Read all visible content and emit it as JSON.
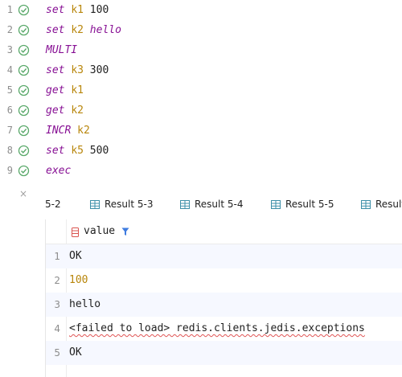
{
  "editor": {
    "lines": [
      {
        "num": "1",
        "parts": [
          "set",
          "k1",
          "100"
        ]
      },
      {
        "num": "2",
        "parts": [
          "set",
          "k2",
          "hello"
        ]
      },
      {
        "num": "3",
        "parts": [
          "MULTI"
        ]
      },
      {
        "num": "4",
        "parts": [
          "set",
          "k3",
          "300"
        ]
      },
      {
        "num": "5",
        "parts": [
          "get",
          "k1"
        ]
      },
      {
        "num": "6",
        "parts": [
          "get",
          "k2"
        ]
      },
      {
        "num": "7",
        "parts": [
          "INCR",
          "k2"
        ]
      },
      {
        "num": "8",
        "parts": [
          "set",
          "k5",
          "500"
        ]
      },
      {
        "num": "9",
        "parts": [
          "exec"
        ]
      }
    ],
    "close_glyph": "×"
  },
  "results": {
    "tabs": [
      "5-2",
      "Result 5-3",
      "Result 5-4",
      "Result 5-5",
      "Result"
    ],
    "column": "value",
    "rows": [
      {
        "num": "1",
        "value": "OK"
      },
      {
        "num": "2",
        "value": "100"
      },
      {
        "num": "3",
        "value": "hello"
      },
      {
        "num": "4",
        "value": "<failed to load> redis.clients.jedis.exceptions"
      },
      {
        "num": "5",
        "value": "OK"
      }
    ]
  },
  "colors": {
    "keyword": "#871094",
    "key": "#b8860b",
    "check": "#59a869",
    "selected_row": "#f6f8ff",
    "filter_icon": "#3f7ce0"
  },
  "icons": [
    "check-circle-icon",
    "close-icon",
    "table-icon",
    "column-icon",
    "filter-icon"
  ]
}
